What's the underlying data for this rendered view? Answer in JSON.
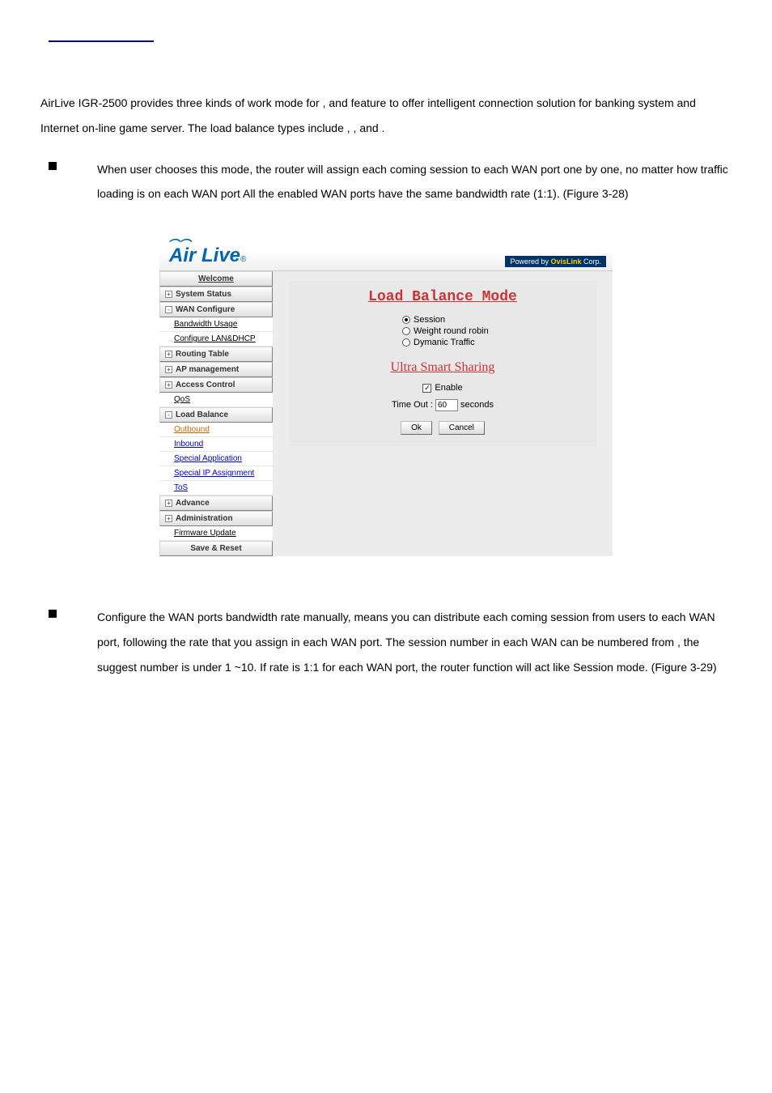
{
  "intro": {
    "line1_a": "AirLive IGR-2500 provides three kinds of work mode for ",
    "line1_b": ", and ",
    "line2": "feature to offer intelligent connection solution for banking system and Internet on-line game server. The load",
    "line3_a": "balance types include ",
    "line3_b": ", ",
    "line3_c": ", and ",
    "line3_d": "."
  },
  "bullet1": {
    "text": "When user chooses this mode, the router will assign each coming session to each WAN port one by one, no matter how traffic loading is on each WAN port  All the enabled WAN ports have the same bandwidth rate (1:1). (Figure 3-28)"
  },
  "screenshot": {
    "logo_main": "Air Live",
    "logo_reg": "®",
    "powered_a": "Powered by ",
    "powered_b": "OvisLink",
    "powered_c": " Corp.",
    "sidebar": {
      "welcome": "Welcome",
      "system_status": "System Status",
      "wan_configure": "WAN Configure",
      "bandwidth_usage": "Bandwidth Usage",
      "configure_lan": "Configure LAN&DHCP",
      "routing_table": "Routing Table",
      "ap_management": "AP management",
      "access_control": "Access Control",
      "qos": "QoS",
      "load_balance": "Load Balance",
      "outbound": "Outbound",
      "inbound": "Inbound",
      "special_app": "Special Application",
      "special_ip": "Special IP Assignment",
      "tos": "ToS",
      "advance": "Advance",
      "administration": "Administration",
      "firmware_update": "Firmware Update",
      "save_reset": "Save & Reset"
    },
    "main": {
      "title": "Load Balance Mode",
      "r1": "Session",
      "r2": "Weight round robin",
      "r3": "Dymanic Traffic",
      "uss": "Ultra Smart Sharing",
      "enable": "Enable",
      "timeout_label_a": "Time Out : ",
      "timeout_value": "60",
      "timeout_label_b": " seconds",
      "ok": "Ok",
      "cancel": "Cancel"
    }
  },
  "bullet2": {
    "text_a": "Configure the WAN ports bandwidth rate manually, means you can distribute each coming session from users to each WAN port, following the rate that you assign in each WAN port. The session number in each WAN can be numbered from ",
    "text_b": ", the suggest number is under 1 ~10. If rate is 1:1 for each WAN port, the router function will act like Session mode. (Figure 3-29)"
  }
}
